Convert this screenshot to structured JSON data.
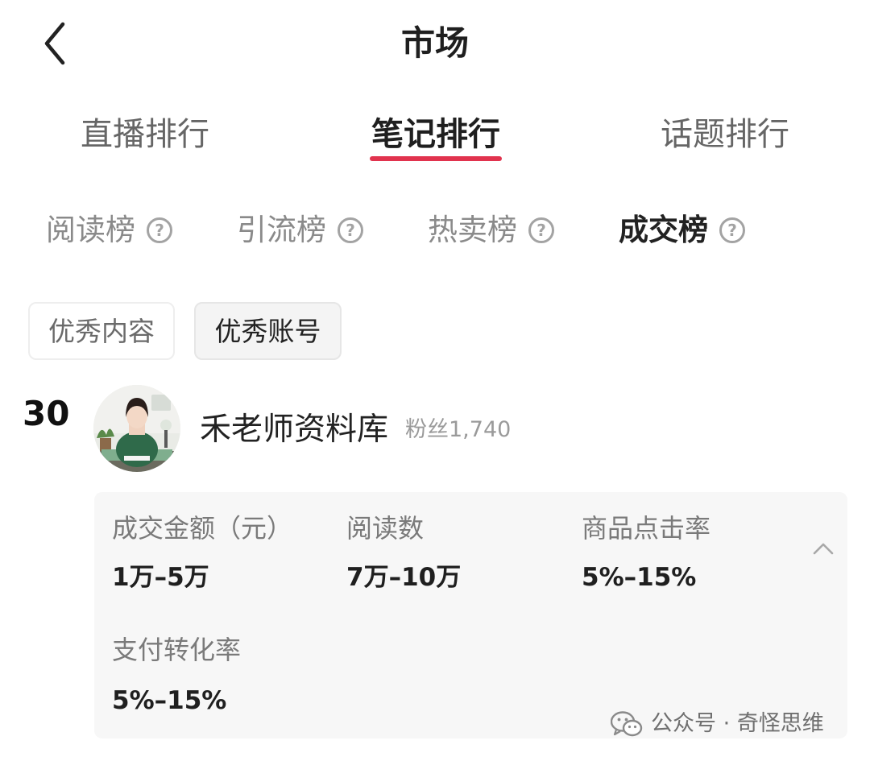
{
  "header": {
    "title": "市场"
  },
  "main_tabs": [
    {
      "label": "直播排行",
      "active": false
    },
    {
      "label": "笔记排行",
      "active": true
    },
    {
      "label": "话题排行",
      "active": false
    }
  ],
  "sub_tabs": [
    {
      "label": "阅读榜",
      "active": false
    },
    {
      "label": "引流榜",
      "active": false
    },
    {
      "label": "热卖榜",
      "active": false
    },
    {
      "label": "成交榜",
      "active": true
    }
  ],
  "help_icon_glyph": "?",
  "filters": [
    {
      "label": "优秀内容",
      "selected": false
    },
    {
      "label": "优秀账号",
      "selected": true
    }
  ],
  "account": {
    "rank": "30",
    "name": "禾老师资料库",
    "fans": "粉丝1,740"
  },
  "stats": [
    {
      "label": "成交金额（元）",
      "value": "1万–5万"
    },
    {
      "label": "阅读数",
      "value": "7万–10万"
    },
    {
      "label": "商品点击率",
      "value": "5%–15%"
    },
    {
      "label": "支付转化率",
      "value": "5%–15%"
    }
  ],
  "watermark": {
    "text": "公众号 · 奇怪思维"
  },
  "colors": {
    "accent": "#e1334e",
    "card_bg": "#f7f7f7",
    "muted_text": "#8a8a8a"
  },
  "icons": {
    "back": "chevron-left-icon",
    "help": "help-circle-icon",
    "collapse": "chevron-up-icon",
    "watermark": "wechat-icon"
  }
}
